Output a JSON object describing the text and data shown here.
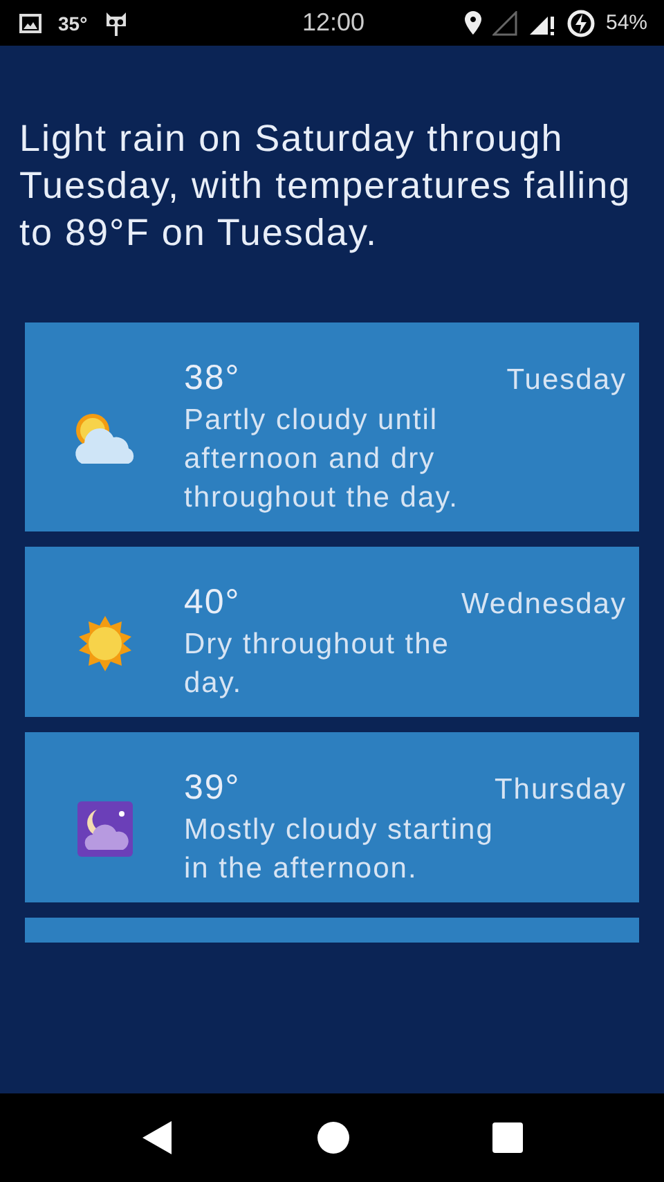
{
  "status_bar": {
    "temperature": "35°",
    "time": "12:00",
    "battery": "54%"
  },
  "summary": "Light rain on Saturday through Tuesday, with temperatures falling to 89°F on Tuesday.",
  "forecasts": [
    {
      "kind": "partly-cloudy",
      "temperature": "38°",
      "day": "Tuesday",
      "description": "Partly cloudy until afternoon and dry throughout the day."
    },
    {
      "kind": "sunny",
      "temperature": "40°",
      "day": "Wednesday",
      "description": "Dry throughout the day."
    },
    {
      "kind": "night-cloudy",
      "temperature": "39°",
      "day": "Thursday",
      "description": "Mostly cloudy starting in the afternoon."
    }
  ]
}
